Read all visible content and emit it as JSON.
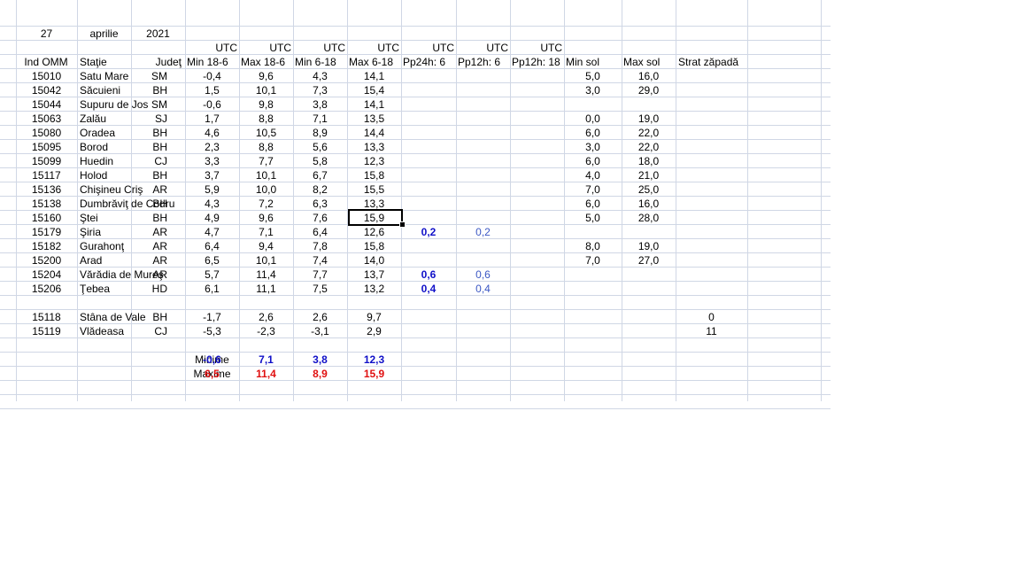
{
  "header_date": {
    "day": "27",
    "month": "aprilie",
    "year": "2021"
  },
  "utc_row": [
    "UTC",
    "UTC",
    "UTC",
    "UTC",
    "UTC",
    "UTC",
    "UTC"
  ],
  "column_headers": [
    "Ind OMM",
    "Staţie",
    "Judeţ",
    "Min 18-6",
    "Max 18-6",
    "Min 6-18",
    "Max 6-18",
    "Pp24h: 6",
    "Pp12h: 6",
    "Pp12h: 18",
    "Min sol",
    "Max sol",
    "Strat zăpadă"
  ],
  "stations": [
    {
      "id": "15010",
      "name": "Satu Mare",
      "county": "SM",
      "min18_6": "-0,4",
      "max18_6": "9,6",
      "min6_18": "4,3",
      "max6_18": "14,1",
      "pp24": "",
      "pp12_6": "",
      "pp12_18": "",
      "min_sol": "5,0",
      "max_sol": "16,0",
      "snow": ""
    },
    {
      "id": "15042",
      "name": "Săcuieni",
      "county": "BH",
      "min18_6": "1,5",
      "max18_6": "10,1",
      "min6_18": "7,3",
      "max6_18": "15,4",
      "pp24": "",
      "pp12_6": "",
      "pp12_18": "",
      "min_sol": "3,0",
      "max_sol": "29,0",
      "snow": ""
    },
    {
      "id": "15044",
      "name": "Supuru de Jos",
      "county": "SM",
      "min18_6": "-0,6",
      "max18_6": "9,8",
      "min6_18": "3,8",
      "max6_18": "14,1",
      "pp24": "",
      "pp12_6": "",
      "pp12_18": "",
      "min_sol": "",
      "max_sol": "",
      "snow": ""
    },
    {
      "id": "15063",
      "name": "Zalău",
      "county": "SJ",
      "min18_6": "1,7",
      "max18_6": "8,8",
      "min6_18": "7,1",
      "max6_18": "13,5",
      "pp24": "",
      "pp12_6": "",
      "pp12_18": "",
      "min_sol": "0,0",
      "max_sol": "19,0",
      "snow": ""
    },
    {
      "id": "15080",
      "name": "Oradea",
      "county": "BH",
      "min18_6": "4,6",
      "max18_6": "10,5",
      "min6_18": "8,9",
      "max6_18": "14,4",
      "pp24": "",
      "pp12_6": "",
      "pp12_18": "",
      "min_sol": "6,0",
      "max_sol": "22,0",
      "snow": ""
    },
    {
      "id": "15095",
      "name": "Borod",
      "county": "BH",
      "min18_6": "2,3",
      "max18_6": "8,8",
      "min6_18": "5,6",
      "max6_18": "13,3",
      "pp24": "",
      "pp12_6": "",
      "pp12_18": "",
      "min_sol": "3,0",
      "max_sol": "22,0",
      "snow": ""
    },
    {
      "id": "15099",
      "name": "Huedin",
      "county": "CJ",
      "min18_6": "3,3",
      "max18_6": "7,7",
      "min6_18": "5,8",
      "max6_18": "12,3",
      "pp24": "",
      "pp12_6": "",
      "pp12_18": "",
      "min_sol": "6,0",
      "max_sol": "18,0",
      "snow": ""
    },
    {
      "id": "15117",
      "name": "Holod",
      "county": "BH",
      "min18_6": "3,7",
      "max18_6": "10,1",
      "min6_18": "6,7",
      "max6_18": "15,8",
      "pp24": "",
      "pp12_6": "",
      "pp12_18": "",
      "min_sol": "4,0",
      "max_sol": "21,0",
      "snow": ""
    },
    {
      "id": "15136",
      "name": "Chişineu   Criş",
      "county": "AR",
      "min18_6": "5,9",
      "max18_6": "10,0",
      "min6_18": "8,2",
      "max6_18": "15,5",
      "pp24": "",
      "pp12_6": "",
      "pp12_18": "",
      "min_sol": "7,0",
      "max_sol": "25,0",
      "snow": ""
    },
    {
      "id": "15138",
      "name": "Dumbrăviţ  de Codru",
      "county": "BH",
      "min18_6": "4,3",
      "max18_6": "7,2",
      "min6_18": "6,3",
      "max6_18": "13,3",
      "pp24": "",
      "pp12_6": "",
      "pp12_18": "",
      "min_sol": "6,0",
      "max_sol": "16,0",
      "snow": ""
    },
    {
      "id": "15160",
      "name": "Ştei",
      "county": "BH",
      "min18_6": "4,9",
      "max18_6": "9,6",
      "min6_18": "7,6",
      "max6_18": "15,9",
      "pp24": "",
      "pp12_6": "",
      "pp12_18": "",
      "min_sol": "5,0",
      "max_sol": "28,0",
      "snow": ""
    },
    {
      "id": "15179",
      "name": "Şiria",
      "county": "AR",
      "min18_6": "4,7",
      "max18_6": "7,1",
      "min6_18": "6,4",
      "max6_18": "12,6",
      "pp24": "0,2",
      "pp12_6": "0,2",
      "pp12_18": "",
      "min_sol": "",
      "max_sol": "",
      "snow": ""
    },
    {
      "id": "15182",
      "name": "Gurahonţ",
      "county": "AR",
      "min18_6": "6,4",
      "max18_6": "9,4",
      "min6_18": "7,8",
      "max6_18": "15,8",
      "pp24": "",
      "pp12_6": "",
      "pp12_18": "",
      "min_sol": "8,0",
      "max_sol": "19,0",
      "snow": ""
    },
    {
      "id": "15200",
      "name": "Arad",
      "county": "AR",
      "min18_6": "6,5",
      "max18_6": "10,1",
      "min6_18": "7,4",
      "max6_18": "14,0",
      "pp24": "",
      "pp12_6": "",
      "pp12_18": "",
      "min_sol": "7,0",
      "max_sol": "27,0",
      "snow": ""
    },
    {
      "id": "15204",
      "name": "Vărădia de Mureş",
      "county": "AR",
      "min18_6": "5,7",
      "max18_6": "11,4",
      "min6_18": "7,7",
      "max6_18": "13,7",
      "pp24": "0,6",
      "pp12_6": "0,6",
      "pp12_18": "",
      "min_sol": "",
      "max_sol": "",
      "snow": ""
    },
    {
      "id": "15206",
      "name": "Ţebea",
      "county": "HD",
      "min18_6": "6,1",
      "max18_6": "11,1",
      "min6_18": "7,5",
      "max6_18": "13,2",
      "pp24": "0,4",
      "pp12_6": "0,4",
      "pp12_18": "",
      "min_sol": "",
      "max_sol": "",
      "snow": ""
    }
  ],
  "mountain_stations": [
    {
      "id": "15118",
      "name": "Stâna de Vale",
      "county": "BH",
      "min18_6": "-1,7",
      "max18_6": "2,6",
      "min6_18": "2,6",
      "max6_18": "9,7",
      "pp24": "",
      "pp12_6": "",
      "pp12_18": "",
      "min_sol": "",
      "max_sol": "",
      "snow": "0"
    },
    {
      "id": "15119",
      "name": "Vlădeasa",
      "county": "CJ",
      "min18_6": "-5,3",
      "max18_6": "-2,3",
      "min6_18": "-3,1",
      "max6_18": "2,9",
      "pp24": "",
      "pp12_6": "",
      "pp12_18": "",
      "min_sol": "",
      "max_sol": "",
      "snow": "11"
    }
  ],
  "summary": {
    "minime": {
      "label": "Minime",
      "values": [
        "-0,6",
        "7,1",
        "3,8",
        "12,3"
      ]
    },
    "maxime": {
      "label": "Maxime",
      "values": [
        "6,5",
        "11,4",
        "8,9",
        "15,9"
      ]
    }
  },
  "colors": {
    "gridline": "#d0d7e5",
    "min_blue": "#1010c8",
    "precip_light_blue": "#3b57c4",
    "max_red": "#e01010"
  }
}
